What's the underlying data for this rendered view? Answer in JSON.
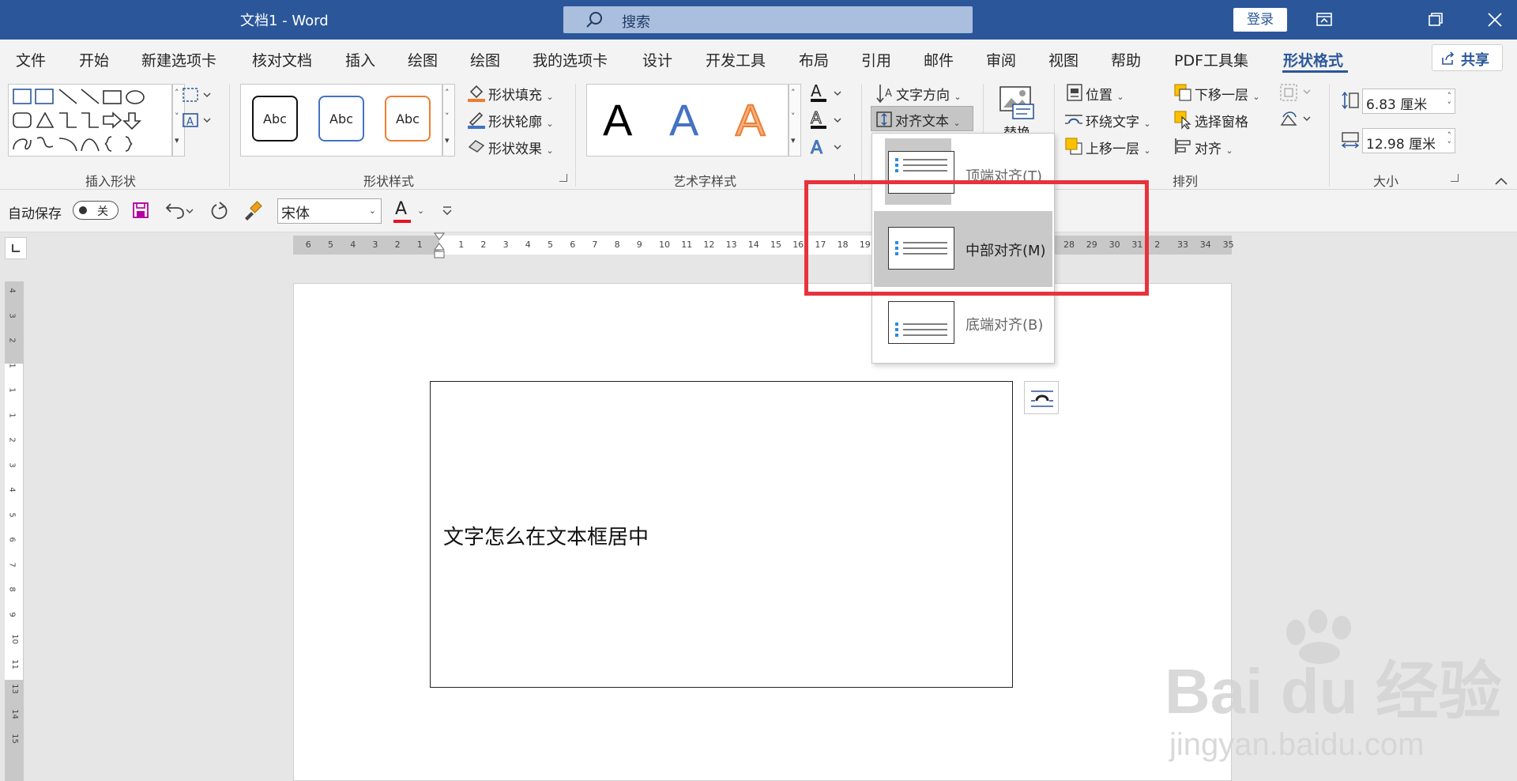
{
  "titlebar": {
    "title": "文档1  -  Word",
    "search_label": "搜索",
    "login_label": "登录",
    "accent": "#2b579a"
  },
  "tabs": [
    {
      "label": "文件"
    },
    {
      "label": "开始"
    },
    {
      "label": "新建选项卡"
    },
    {
      "label": "核对文档"
    },
    {
      "label": "插入"
    },
    {
      "label": "绘图"
    },
    {
      "label": "绘图"
    },
    {
      "label": "我的选项卡"
    },
    {
      "label": "设计"
    },
    {
      "label": "开发工具"
    },
    {
      "label": "布局"
    },
    {
      "label": "引用"
    },
    {
      "label": "邮件"
    },
    {
      "label": "审阅"
    },
    {
      "label": "视图"
    },
    {
      "label": "帮助"
    },
    {
      "label": "PDF工具集"
    },
    {
      "label": "形状格式",
      "active": true
    }
  ],
  "share_label": "共享",
  "ribbon": {
    "groups": {
      "insert_shapes": "插入形状",
      "shape_styles": "形状样式",
      "wordart_styles": "艺术字样式",
      "arrange": "排列",
      "size": "大小"
    },
    "shape_style_samples": [
      "Abc",
      "Abc",
      "Abc"
    ],
    "shape_fill": "形状填充",
    "shape_outline": "形状轮廓",
    "shape_effects": "形状效果",
    "wordart_samples": [
      "A",
      "A",
      "A"
    ],
    "text_direction": "文字方向",
    "align_text": "对齐文本",
    "replace": "替换",
    "position": "位置",
    "wrap_text": "环绕文字",
    "bring_forward": "上移一层",
    "send_backward": "下移一层",
    "selection_pane": "选择窗格",
    "align": "对齐",
    "height": "6.83 厘米",
    "width": "12.98 厘米"
  },
  "qat": {
    "autosave": "自动保存",
    "autosave_state": "关",
    "font": "宋体",
    "font_color_letter": "A"
  },
  "ruler": {
    "left_ticks": [
      "6",
      "5",
      "4",
      "3",
      "2",
      "1"
    ],
    "right_ticks": [
      "1",
      "2",
      "3",
      "4",
      "5",
      "6",
      "7",
      "8",
      "9",
      "10",
      "11",
      "12",
      "13",
      "14",
      "15",
      "16",
      "17",
      "18",
      "19"
    ],
    "far_ticks": [
      "28",
      "29",
      "30",
      "31",
      "2",
      "33",
      "34",
      "35"
    ],
    "vertical_ticks": [
      "4",
      "3",
      "2",
      "1",
      "1",
      "1",
      "2",
      "3",
      "4",
      "5",
      "6",
      "7",
      "8",
      "9",
      "10",
      "11",
      "13",
      "14",
      "15"
    ]
  },
  "document": {
    "textbox_text": "文字怎么在文本框居中"
  },
  "dropdown": {
    "items": [
      {
        "label": "顶端对齐(T)",
        "key": "T",
        "selected": false
      },
      {
        "label": "中部对齐(M)",
        "key": "M",
        "selected": true
      },
      {
        "label": "底端对齐(B)",
        "key": "B",
        "selected": false
      }
    ]
  },
  "watermark": {
    "logo": "Bai du 经验",
    "url": "jingyan.baidu.com"
  },
  "colors": {
    "highlight": "#e8323c",
    "ribbon_bg": "#f3f3f3"
  }
}
